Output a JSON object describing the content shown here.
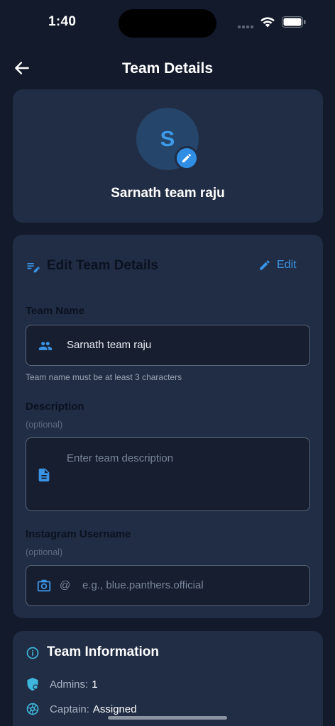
{
  "status_bar": {
    "time": "1:40"
  },
  "nav": {
    "title": "Team Details"
  },
  "profile": {
    "avatar_initial": "S",
    "team_name": "Sarnath team raju"
  },
  "edit_section": {
    "title": "Edit Team Details",
    "edit_label": "Edit",
    "team_name": {
      "label": "Team Name",
      "value": "Sarnath team raju",
      "helper": "Team name must be at least 3 characters"
    },
    "description": {
      "label": "Description",
      "optional": "(optional)",
      "placeholder": "Enter team description"
    },
    "instagram": {
      "label": "Instagram Username",
      "optional": "(optional)",
      "prefix": "@",
      "placeholder": "e.g., blue.panthers.official"
    }
  },
  "info_section": {
    "title": "Team Information",
    "rows": [
      {
        "label": "Admins:",
        "value": "1",
        "icon": "admin-shield-icon"
      },
      {
        "label": "Captain:",
        "value": "Assigned",
        "icon": "captain-wheel-icon"
      }
    ]
  },
  "colors": {
    "background": "#121a2b",
    "card": "#212d44",
    "accent": "#3a94e6",
    "info_accent": "#3fb6dc"
  }
}
